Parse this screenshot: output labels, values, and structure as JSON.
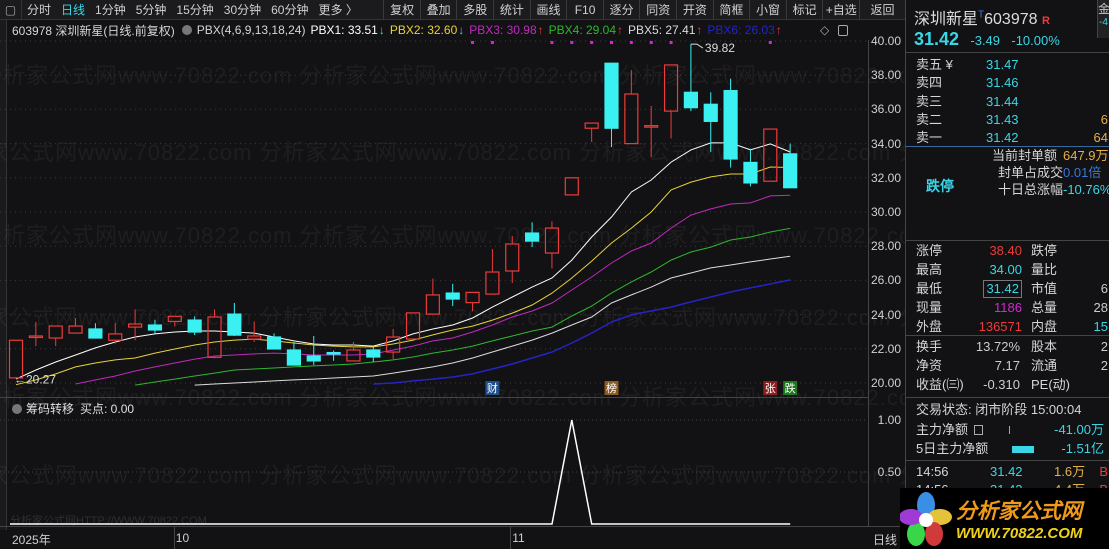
{
  "toolbar": {
    "periods": [
      "分时",
      "日线",
      "1分钟",
      "5分钟",
      "15分钟",
      "30分钟",
      "60分钟",
      "更多 〉"
    ],
    "active_period": "日线",
    "buttons": [
      "复权",
      "叠加",
      "多股",
      "统计",
      "画线",
      "F10",
      "逐分",
      "同资",
      "开资",
      "简框",
      "小窗",
      "标记",
      "+自选"
    ],
    "back": "返回"
  },
  "info": {
    "title": "603978 深圳新星(日线.前复权)",
    "indicator": "PBX(4,6,9,13,18,24)",
    "legends": [
      {
        "label": "PBX1: 33.51",
        "arrow": "↓",
        "color": "#ffffff",
        "arrow_color": "#3ad6e6"
      },
      {
        "label": "PBX2: 32.60",
        "arrow": "↓",
        "color": "#e6d23a",
        "arrow_color": "#3ad6e6"
      },
      {
        "label": "PBX3: 30.98",
        "arrow": "↑",
        "color": "#c02ac0",
        "arrow_color": "#ee3b3b"
      },
      {
        "label": "PBX4: 29.04",
        "arrow": "↑",
        "color": "#2eb82e",
        "arrow_color": "#ee3b3b"
      },
      {
        "label": "PBX5: 27.41",
        "arrow": "↑",
        "color": "#dddddd",
        "arrow_color": "#ee3b3b"
      },
      {
        "label": "PBX6: 26.03",
        "arrow": "↑",
        "color": "#2424c8",
        "arrow_color": "#ee3b3b"
      }
    ],
    "diamond_icon": "◇"
  },
  "watermark": "分析家公式网www.70822.com",
  "lower_watermark": "分析家公式网HTTP://WWW.70822.COM",
  "chart_data": [
    {
      "type": "candlestick",
      "title": "603978 深圳新星(日线.前复权)",
      "ylim": [
        20,
        40
      ],
      "y_ticks": [
        "40.00",
        "38.00",
        "36.00",
        "34.00",
        "32.00",
        "30.00",
        "28.00",
        "26.00",
        "24.00",
        "22.00",
        "20.00"
      ],
      "candles": [
        [
          20.3,
          22.5,
          20.27,
          22.5
        ],
        [
          22.7,
          23.57,
          22.16,
          22.75
        ],
        [
          22.63,
          23.33,
          22.16,
          23.33
        ],
        [
          22.92,
          23.8,
          22.92,
          23.33
        ],
        [
          23.16,
          23.5,
          22.63,
          22.63
        ],
        [
          22.5,
          23.5,
          22.3,
          22.87
        ],
        [
          23.27,
          24.3,
          22.5,
          23.45
        ],
        [
          23.39,
          23.7,
          22.9,
          23.1
        ],
        [
          23.6,
          23.9,
          23.3,
          23.9
        ],
        [
          23.68,
          23.9,
          22.8,
          22.98
        ],
        [
          21.5,
          24.3,
          21.45,
          23.86
        ],
        [
          24.03,
          24.68,
          22.75,
          22.8
        ],
        [
          22.57,
          23.6,
          22.4,
          22.75
        ],
        [
          22.69,
          22.9,
          21.99,
          21.99
        ],
        [
          21.93,
          22.4,
          21.05,
          21.05
        ],
        [
          21.58,
          22.75,
          21.05,
          21.29
        ],
        [
          21.78,
          21.9,
          21.3,
          21.72
        ],
        [
          21.29,
          22.4,
          21.29,
          21.93
        ],
        [
          21.93,
          22.1,
          21.23,
          21.52
        ],
        [
          21.81,
          23.16,
          21.4,
          22.69
        ],
        [
          22.57,
          24.1,
          22.57,
          24.1
        ],
        [
          24.03,
          26.1,
          24.03,
          25.15
        ],
        [
          25.26,
          25.8,
          24.5,
          24.91
        ],
        [
          24.7,
          25.3,
          24.2,
          25.3
        ],
        [
          25.2,
          27.84,
          25.2,
          26.49
        ],
        [
          26.55,
          28.6,
          25.85,
          28.13
        ],
        [
          28.77,
          29.4,
          27.95,
          28.3
        ],
        [
          27.6,
          29.45,
          26.7,
          29.06
        ],
        [
          31.0,
          32.0,
          31.0,
          32.0
        ],
        [
          34.9,
          35.2,
          34.1,
          35.2
        ],
        [
          38.7,
          38.7,
          33.8,
          34.9
        ],
        [
          34.0,
          38.3,
          34.0,
          36.9
        ],
        [
          35.0,
          36.2,
          33.2,
          35.05
        ],
        [
          35.9,
          38.6,
          34.3,
          38.6
        ],
        [
          37.0,
          39.82,
          35.9,
          36.1
        ],
        [
          36.3,
          37.0,
          33.5,
          35.3
        ],
        [
          37.1,
          37.8,
          32.6,
          33.1
        ],
        [
          32.9,
          33.7,
          31.5,
          31.7
        ],
        [
          31.8,
          34.85,
          31.8,
          34.85
        ],
        [
          33.4,
          34.0,
          31.42,
          31.42
        ]
      ],
      "series": [
        {
          "name": "PBX1",
          "color": "#ffffff",
          "start": 0,
          "values": [
            20.23,
            20.76,
            21.23,
            21.64,
            22.05,
            22.4,
            22.69,
            22.87,
            22.98,
            23.04,
            23.04,
            22.98,
            22.92,
            22.69,
            22.46,
            22.28,
            22.22,
            22.22,
            22.16,
            22.46,
            22.87,
            23.16,
            23.39,
            23.8,
            24.44,
            25.03,
            25.61,
            26.14,
            27.19,
            28.54,
            29.71,
            31.17,
            31.87,
            32.92,
            33.63,
            34.04,
            34.04,
            33.63,
            33.98,
            33.51
          ]
        },
        {
          "name": "PBX2",
          "color": "#e6d23a",
          "start": 0,
          "values": [
            19.9,
            20.18,
            20.53,
            20.94,
            21.17,
            21.35,
            21.46,
            21.75,
            21.99,
            22.22,
            22.4,
            22.51,
            22.57,
            22.46,
            22.34,
            22.22,
            22.16,
            22.11,
            22.11,
            22.28,
            22.51,
            22.81,
            23.1,
            23.33,
            23.68,
            24.09,
            24.56,
            25.26,
            26.14,
            27.13,
            28.19,
            29.06,
            30.0,
            31.29,
            31.75,
            32.05,
            32.22,
            32.22,
            32.63,
            32.6
          ]
        },
        {
          "name": "PBX3",
          "color": "#c02ac0",
          "start": 3,
          "values": [
            19.94,
            20.18,
            20.41,
            20.7,
            20.94,
            21.17,
            21.4,
            21.58,
            21.64,
            21.7,
            21.75,
            21.7,
            21.64,
            21.64,
            21.64,
            21.7,
            21.93,
            22.16,
            22.46,
            22.63,
            22.98,
            23.39,
            23.86,
            24.21,
            24.68,
            25.44,
            26.2,
            27.02,
            27.72,
            28.19,
            29.06,
            29.82,
            30.18,
            30.47,
            30.53,
            30.94,
            30.98
          ]
        },
        {
          "name": "PBX4",
          "color": "#2eb82e",
          "start": 6,
          "values": [
            19.88,
            20.06,
            20.23,
            20.41,
            20.58,
            20.76,
            20.82,
            20.88,
            20.94,
            21.0,
            21.05,
            21.11,
            21.23,
            21.35,
            21.52,
            21.75,
            21.93,
            22.16,
            22.46,
            22.75,
            23.04,
            23.27,
            23.92,
            24.5,
            25.26,
            25.91,
            26.49,
            27.19,
            27.66,
            27.95,
            28.36,
            28.54,
            28.83,
            29.04
          ]
        },
        {
          "name": "PBX5",
          "color": "#dddddd",
          "start": 9,
          "values": [
            19.88,
            19.94,
            20.0,
            20.06,
            20.12,
            20.18,
            20.23,
            20.29,
            20.35,
            20.41,
            20.58,
            20.76,
            20.94,
            21.17,
            21.46,
            21.81,
            22.16,
            22.51,
            22.92,
            23.39,
            23.86,
            24.68,
            25.15,
            25.61,
            26.14,
            26.43,
            26.73,
            26.9,
            27.08,
            27.25,
            27.41
          ]
        },
        {
          "name": "PBX6",
          "color": "#2424c8",
          "start": 18,
          "values": [
            19.94,
            20.0,
            20.12,
            20.23,
            20.35,
            20.53,
            20.82,
            21.11,
            21.46,
            21.81,
            22.34,
            22.92,
            23.57,
            23.98,
            24.21,
            24.44,
            24.74,
            25.03,
            25.32,
            25.56,
            25.79,
            26.03
          ]
        }
      ],
      "annotations": {
        "high_label": "39.82",
        "high_index": 34,
        "low_label": "20.27",
        "low_index": 0
      },
      "event_markers": [
        {
          "index": 24,
          "text": "财",
          "color": "#1f4f8a"
        },
        {
          "index": 30,
          "text": "榜",
          "color": "#8a5a1f"
        },
        {
          "index": 38,
          "text": "张",
          "color": "#8a1f1f"
        },
        {
          "index": 39,
          "text": "跌",
          "color": "#1f7a1f"
        }
      ],
      "signal_dot_indices": [
        23,
        24,
        27,
        28,
        29,
        30,
        31,
        32,
        33,
        38
      ],
      "x_labels": [
        {
          "index": 0,
          "text": "2025年"
        },
        {
          "index": 8,
          "text": "10"
        },
        {
          "index": 25,
          "text": "11"
        }
      ],
      "period_label": "日线"
    },
    {
      "type": "line",
      "title": "筹码转移",
      "legend": "买点: 0.00",
      "ylim": [
        0,
        1.2
      ],
      "y_ticks": [
        "1.00",
        "0.50"
      ],
      "y_tick_values": [
        1.0,
        0.5
      ],
      "values": [
        0,
        0,
        0,
        0,
        0,
        0,
        0,
        0,
        0,
        0,
        0,
        0,
        0,
        0,
        0,
        0,
        0,
        0,
        0,
        0,
        0,
        0,
        0,
        0,
        0,
        0,
        0,
        0,
        1,
        0,
        0,
        0,
        0,
        0,
        0,
        0,
        0,
        0,
        0,
        0
      ]
    }
  ],
  "quote": {
    "name": "深圳新星",
    "t_mark": "T",
    "code": "603978",
    "r_mark": "R",
    "side_tab": "金",
    "side_tab_value": "-4",
    "price": "31.42",
    "change": "-3.49",
    "change_pct": "-10.00%",
    "asks": [
      {
        "label": "卖五 ¥",
        "price": "31.47",
        "vol": ""
      },
      {
        "label": "卖四",
        "price": "31.46",
        "vol": ""
      },
      {
        "label": "卖三",
        "price": "31.44",
        "vol": ""
      },
      {
        "label": "卖二",
        "price": "31.43",
        "vol": "6"
      },
      {
        "label": "卖一",
        "price": "31.42",
        "vol": "64"
      }
    ],
    "seal_amount_label": "当前封单额",
    "seal_amount": "647.9万",
    "seal_ratio_label": "封单占成交",
    "seal_ratio": "0.01倍",
    "ten_day_label": "十日总涨幅",
    "ten_day": "-10.76%",
    "limit_status": "跌停",
    "stats": [
      {
        "l1": "涨停",
        "v1": "38.40",
        "c1": "red",
        "l2": "跌停",
        "v2": ""
      },
      {
        "l1": "最高",
        "v1": "34.00",
        "c1": "cyan",
        "l2": "量比",
        "v2": ""
      },
      {
        "l1": "最低",
        "v1": "31.42",
        "c1": "cyan",
        "l2": "市值",
        "v2": "6"
      },
      {
        "l1": "现量",
        "v1": "1186",
        "c1": "mag",
        "l2": "总量",
        "v2": "28"
      },
      {
        "l1": "外盘",
        "v1": "136571",
        "c1": "red",
        "l2": "内盘",
        "v2": "15"
      }
    ],
    "stats2": [
      {
        "l1": "换手",
        "v1": "13.72%",
        "l2": "股本",
        "v2": "2"
      },
      {
        "l1": "净资",
        "v1": "7.17",
        "l2": "流通",
        "v2": "2"
      },
      {
        "l1": "收益(㈢)",
        "v1": "-0.310",
        "l2": "PE(动)",
        "v2": ""
      }
    ],
    "trade_status": "交易状态: 闭市阶段 15:00:04",
    "main_net_label": "主力净额",
    "main_net": "-41.00万",
    "main_net_5d_label": "5日主力净额",
    "main_net_5d": "-1.51亿",
    "ticks": [
      {
        "time": "14:56",
        "price": "31.42",
        "vol": "1.6万",
        "side": "B"
      },
      {
        "time": "14:56",
        "price": "31.42",
        "vol": "4.4万",
        "side": "B"
      }
    ]
  },
  "logo": {
    "cn": "分析家公式网",
    "url": "WWW.70822.COM"
  }
}
